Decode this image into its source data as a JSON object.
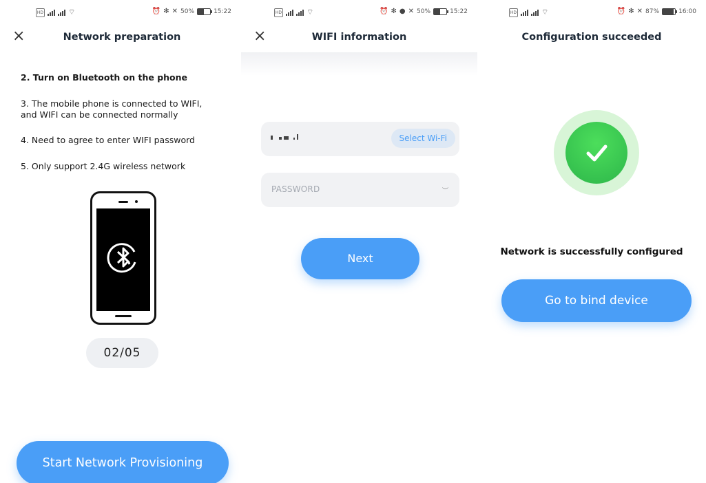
{
  "screens": [
    {
      "status": {
        "carrier_left": "⁴⁶",
        "time": "15:22",
        "battery_text": "50%",
        "battery_level": 0.5
      },
      "title": "Network preparation",
      "steps": [
        "2. Turn on Bluetooth on the phone",
        "3. The mobile phone is connected to WIFI,\nand WIFI can be connected normally",
        "4. Need to agree to enter WIFI password",
        "5. Only support 2.4G wireless network"
      ],
      "pager": "02/05",
      "button": "Start Network Provisioning"
    },
    {
      "status": {
        "time": "15:22",
        "battery_text": "50%",
        "battery_level": 0.5
      },
      "title": "WIFI information",
      "select_wifi": "Select Wi-Fi",
      "password_placeholder": "PASSWORD",
      "button": "Next"
    },
    {
      "status": {
        "time": "16:00",
        "battery_text": "87%",
        "battery_level": 0.87
      },
      "title": "Configuration succeeded",
      "message": "Network is successfully configured",
      "button": "Go to bind device"
    }
  ],
  "icons": {
    "close": "close-icon",
    "bluetooth": "bluetooth-icon",
    "check": "checkmark-icon",
    "eye": "eye-closed-icon"
  },
  "colors": {
    "accent": "#4a9ef7",
    "success": "#3dca55",
    "success_ring": "#d8f5d7"
  }
}
